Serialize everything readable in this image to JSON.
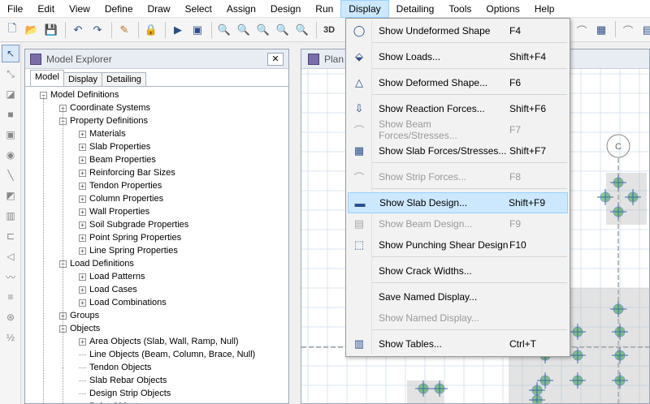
{
  "menubar": {
    "items": [
      "File",
      "Edit",
      "View",
      "Define",
      "Draw",
      "Select",
      "Assign",
      "Design",
      "Run",
      "Display",
      "Detailing",
      "Tools",
      "Options",
      "Help"
    ],
    "active": "Display"
  },
  "toolbar": {
    "label_3d": "3D"
  },
  "explorer": {
    "title": "Model Explorer",
    "close_label": "✕",
    "tabs": [
      "Model",
      "Display",
      "Detailing"
    ],
    "active_tab": "Model",
    "tree": [
      {
        "label": "Model Definitions",
        "level": 0,
        "toggle": "-"
      },
      {
        "label": "Coordinate Systems",
        "level": 1,
        "toggle": "+"
      },
      {
        "label": "Property Definitions",
        "level": 1,
        "toggle": "-"
      },
      {
        "label": "Materials",
        "level": 2,
        "toggle": "+"
      },
      {
        "label": "Slab Properties",
        "level": 2,
        "toggle": "+"
      },
      {
        "label": "Beam Properties",
        "level": 2,
        "toggle": "+"
      },
      {
        "label": "Reinforcing Bar Sizes",
        "level": 2,
        "toggle": "+"
      },
      {
        "label": "Tendon Properties",
        "level": 2,
        "toggle": "+"
      },
      {
        "label": "Column Properties",
        "level": 2,
        "toggle": "+"
      },
      {
        "label": "Wall Properties",
        "level": 2,
        "toggle": "+"
      },
      {
        "label": "Soil Subgrade Properties",
        "level": 2,
        "toggle": "+"
      },
      {
        "label": "Point Spring Properties",
        "level": 2,
        "toggle": "+"
      },
      {
        "label": "Line Spring Properties",
        "level": 2,
        "toggle": "+"
      },
      {
        "label": "Load Definitions",
        "level": 1,
        "toggle": "-"
      },
      {
        "label": "Load Patterns",
        "level": 2,
        "toggle": "+"
      },
      {
        "label": "Load Cases",
        "level": 2,
        "toggle": "+"
      },
      {
        "label": "Load Combinations",
        "level": 2,
        "toggle": "+"
      },
      {
        "label": "Groups",
        "level": 1,
        "toggle": "+"
      },
      {
        "label": "Objects",
        "level": 1,
        "toggle": "-"
      },
      {
        "label": "Area Objects (Slab, Wall, Ramp, Null)",
        "level": 2,
        "toggle": "+"
      },
      {
        "label": "Line Objects (Beam, Column, Brace, Null)",
        "level": 2,
        "toggle": ""
      },
      {
        "label": "Tendon Objects",
        "level": 2,
        "toggle": ""
      },
      {
        "label": "Slab Rebar Objects",
        "level": 2,
        "toggle": ""
      },
      {
        "label": "Design Strip Objects",
        "level": 2,
        "toggle": ""
      },
      {
        "label": "Point Objects",
        "level": 2,
        "toggle": "+"
      }
    ]
  },
  "plan": {
    "title": "Plan",
    "grid_bubble": "C"
  },
  "display_menu": {
    "items": [
      {
        "label": "Show Undeformed Shape",
        "shortcut": "F4",
        "icon": "circle-icon",
        "enabled": true
      },
      {
        "label": "Show Loads...",
        "shortcut": "Shift+F4",
        "icon": "loads-icon",
        "enabled": true
      },
      {
        "label": "Show Deformed Shape...",
        "shortcut": "F6",
        "icon": "deformed-shape-icon",
        "enabled": true
      },
      {
        "label": "Show Reaction Forces...",
        "shortcut": "Shift+F6",
        "icon": "reaction-icon",
        "enabled": true
      },
      {
        "label": "Show Beam Forces/Stresses...",
        "shortcut": "F7",
        "icon": "beam-forces-icon",
        "enabled": false
      },
      {
        "label": "Show Slab Forces/Stresses...",
        "shortcut": "Shift+F7",
        "icon": "slab-forces-icon",
        "enabled": true
      },
      {
        "label": "Show Strip Forces...",
        "shortcut": "F8",
        "icon": "strip-forces-icon",
        "enabled": false
      },
      {
        "label": "Show Slab Design...",
        "shortcut": "Shift+F9",
        "icon": "slab-design-icon",
        "enabled": true,
        "highlighted": true
      },
      {
        "label": "Show Beam Design...",
        "shortcut": "F9",
        "icon": "beam-design-icon",
        "enabled": false
      },
      {
        "label": "Show Punching Shear Design",
        "shortcut": "F10",
        "icon": "punching-shear-icon",
        "enabled": true
      },
      {
        "label": "Show Crack Widths...",
        "shortcut": "",
        "icon": "",
        "enabled": true
      },
      {
        "label": "Save Named Display...",
        "shortcut": "",
        "icon": "",
        "enabled": true
      },
      {
        "label": "Show Named Display...",
        "shortcut": "",
        "icon": "",
        "enabled": false
      },
      {
        "label": "Show Tables...",
        "shortcut": "Ctrl+T",
        "icon": "tables-icon",
        "enabled": true
      }
    ]
  },
  "colors": {
    "accent_highlight": "#cce8ff",
    "grid_line": "#4a90c8",
    "column_fill": "#b0b0b0",
    "rebar_green": "#2e9e3e"
  }
}
